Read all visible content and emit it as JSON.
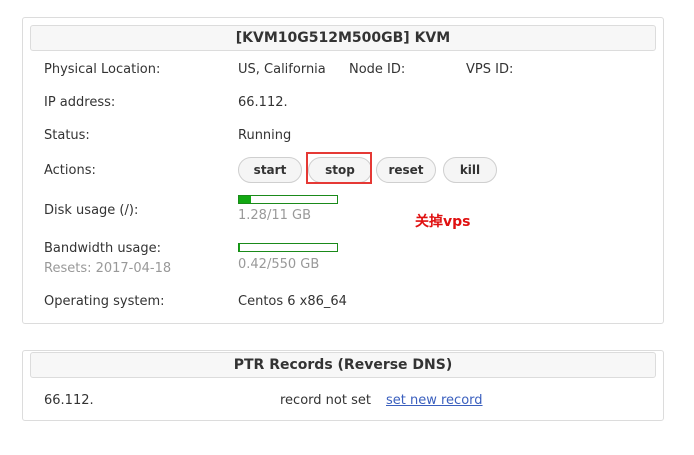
{
  "server_panel": {
    "title": "[KVM10G512M500GB]   KVM",
    "physical_location": {
      "label": "Physical Location:",
      "value": "US, California"
    },
    "node_id_label": "Node ID:",
    "vps_id_label": "VPS ID:",
    "ip": {
      "label": "IP address:",
      "value": "66.112."
    },
    "status": {
      "label": "Status:",
      "value": "Running"
    },
    "actions": {
      "label": "Actions:",
      "buttons": [
        "start",
        "stop",
        "reset",
        "kill"
      ]
    },
    "disk": {
      "label": "Disk usage (/):",
      "value": "1.28/11 GB",
      "fraction": 0.12,
      "bar_color": "#12a812"
    },
    "bandwidth": {
      "label": "Bandwidth usage:",
      "resets": "Resets: 2017-04-18",
      "value": "0.42/550 GB",
      "fraction": 0.0008,
      "bar_color": "#12a812"
    },
    "os": {
      "label": "Operating system:",
      "value": "Centos 6 x86_64"
    }
  },
  "annotation": {
    "text": "关掉vps",
    "color": "#e01010"
  },
  "ptr_panel": {
    "title": "PTR Records (Reverse DNS)",
    "ip": "66.112.",
    "status": "record not set",
    "link": "set new record"
  }
}
